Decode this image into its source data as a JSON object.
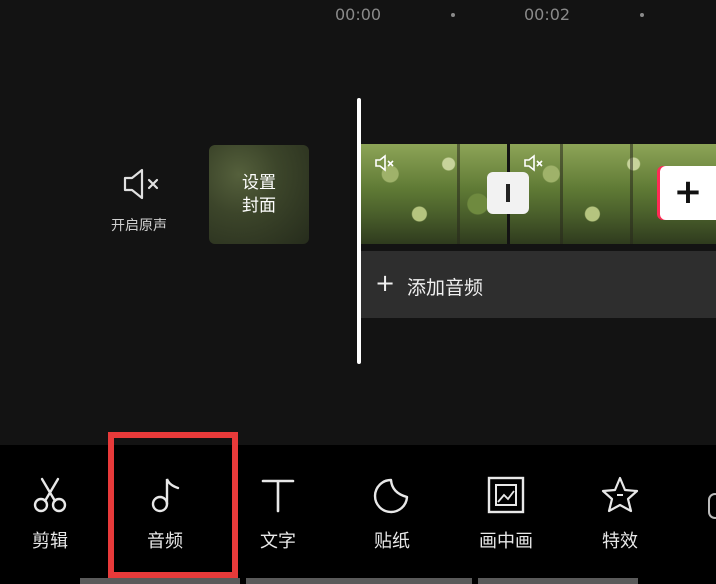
{
  "ruler": {
    "time_start": "00:00",
    "time_next": "00:02"
  },
  "timeline": {
    "mute_label": "开启原声",
    "cover_label_line1": "设置",
    "cover_label_line2": "封面",
    "add_audio_label": "添加音频",
    "add_audio_icon": "plus-icon",
    "add_clip_icon": "plus-icon"
  },
  "toolbar": {
    "items": [
      {
        "label": "剪辑",
        "icon": "scissors-icon"
      },
      {
        "label": "音频",
        "icon": "music-note-icon"
      },
      {
        "label": "文字",
        "icon": "text-icon"
      },
      {
        "label": "贴纸",
        "icon": "sticker-icon"
      },
      {
        "label": "画中画",
        "icon": "picture-in-picture-icon"
      },
      {
        "label": "特效",
        "icon": "star-effect-icon"
      }
    ],
    "selected": "音频"
  },
  "colors": {
    "background": "#131313",
    "toolbar": "#000000",
    "highlight": "#e83a3a",
    "audio_track": "#2e2e2e"
  }
}
